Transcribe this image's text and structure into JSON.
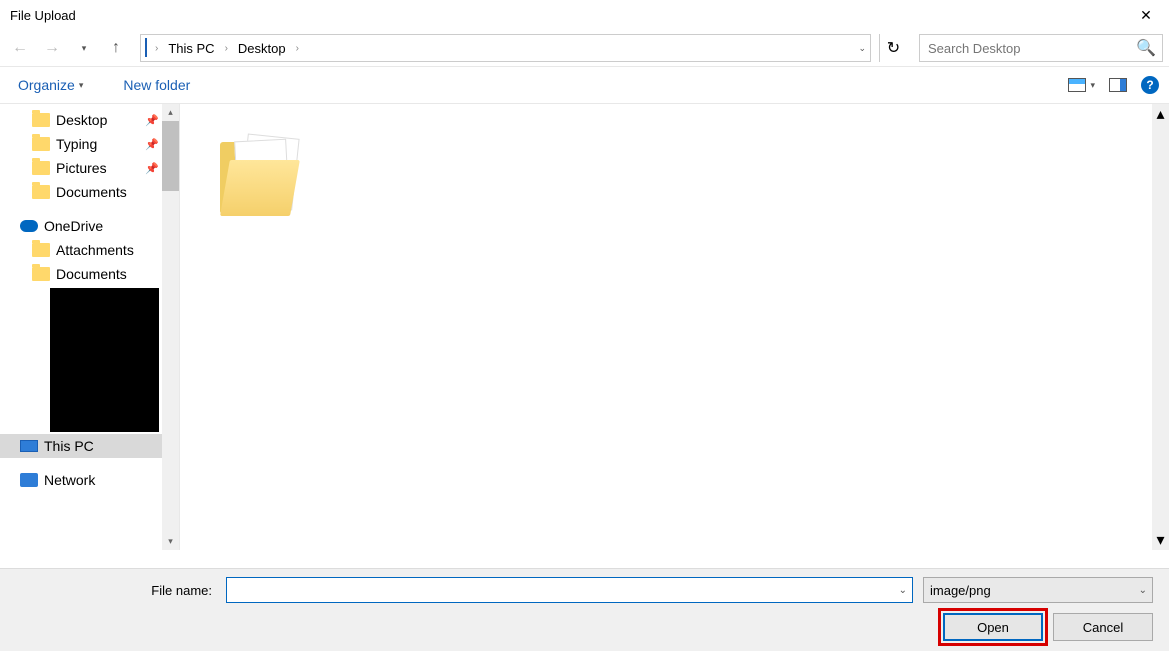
{
  "title": "File Upload",
  "breadcrumb": {
    "root": "This PC",
    "segments": [
      "Desktop"
    ]
  },
  "search": {
    "placeholder": "Search Desktop"
  },
  "toolbar": {
    "organize": "Organize",
    "newfolder": "New folder"
  },
  "sidebar": {
    "quick": [
      {
        "label": "Desktop",
        "pinned": true
      },
      {
        "label": "Typing",
        "pinned": true
      },
      {
        "label": "Pictures",
        "pinned": true
      },
      {
        "label": "Documents",
        "pinned": false
      }
    ],
    "onedrive": {
      "label": "OneDrive",
      "children": [
        "Attachments",
        "Documents"
      ]
    },
    "thispc": "This PC",
    "network": "Network"
  },
  "bottom": {
    "filename_label": "File name:",
    "filename_value": "",
    "filter": "image/png",
    "open": "Open",
    "cancel": "Cancel"
  }
}
